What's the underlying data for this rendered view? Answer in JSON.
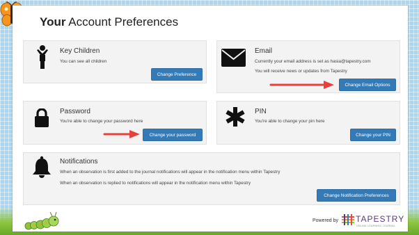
{
  "page": {
    "title_bold": "Your",
    "title_rest": "Account Preferences"
  },
  "cards": {
    "key_children": {
      "title": "Key Children",
      "lines": [
        "You can see all children"
      ],
      "button": "Change Preference",
      "icon": "person-icon"
    },
    "email": {
      "title": "Email",
      "lines": [
        "Currently your email address is set as hasia@tapestry.com",
        "You will receive news or updates from Tapestry"
      ],
      "button": "Change Email Options",
      "icon": "envelope-icon"
    },
    "password": {
      "title": "Password",
      "lines": [
        "You're able to change your password here"
      ],
      "button": "Change your password",
      "icon": "lock-icon"
    },
    "pin": {
      "title": "PIN",
      "lines": [
        "You're able to change your pin here"
      ],
      "button": "Change your PIN",
      "icon": "asterisk-icon"
    },
    "notifications": {
      "title": "Notifications",
      "lines": [
        "When an observation is first added to the journal notifications will appear in the notification menu within Tapestry",
        "When an observation is replied to notifications will appear in the notification menu within Tapestry"
      ],
      "button": "Change Notification Preferences",
      "icon": "bell-icon"
    }
  },
  "footer": {
    "powered_by": "Powered by",
    "brand": "TAPESTRY",
    "brand_sub": "ONLINE LEARNING JOURNAL"
  },
  "colors": {
    "button": "#337ab7",
    "arrow": "#e8413c",
    "card_bg": "#f3f3f3",
    "background": "#a9d7f3",
    "grass": "#8cc63f"
  }
}
